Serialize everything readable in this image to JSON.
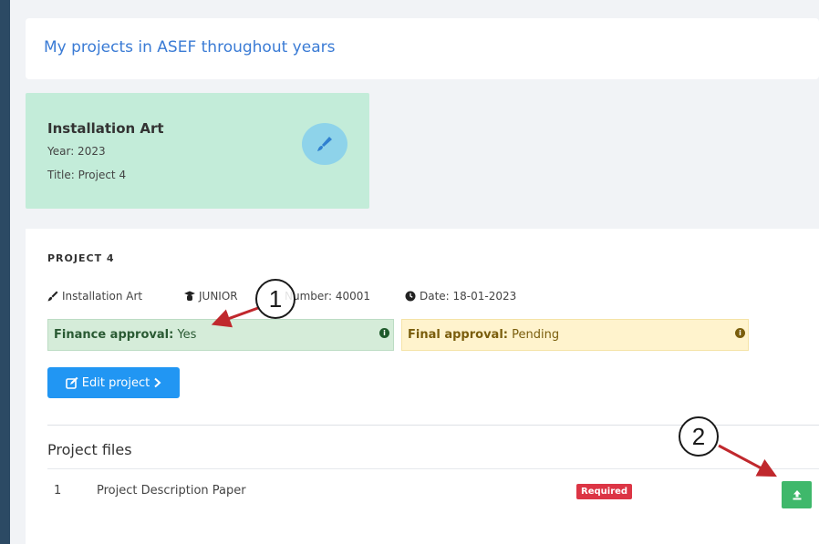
{
  "page_title": "My projects in ASEF throughout years",
  "project_tile": {
    "category": "Installation Art",
    "year_line": "Year: 2023",
    "title_line": "Title: Project 4",
    "icon": "paintbrush-icon"
  },
  "project": {
    "heading": "PROJECT 4",
    "meta": {
      "category": "Installation Art",
      "level": "JUNIOR",
      "number": "Number: 40001",
      "date": "Date: 18-01-2023"
    },
    "finance_approval": {
      "label": "Finance approval:",
      "value": "Yes"
    },
    "final_approval": {
      "label": "Final approval:",
      "value": "Pending"
    },
    "edit_button": "Edit project"
  },
  "files": {
    "heading": "Project files",
    "rows": [
      {
        "num": "1",
        "name": "Project Description Paper",
        "badge": "Required"
      }
    ]
  },
  "callouts": {
    "one": "1",
    "two": "2"
  },
  "colors": {
    "accent": "#3a7bd5",
    "tile_bg": "#c3ecd9",
    "finance_bg": "#d5ecd9",
    "final_bg": "#fff3cd",
    "edit_button": "#2196f3",
    "badge_required": "#dc3545",
    "upload_button": "#3fb86b",
    "annotation_arrow": "#c0282d"
  }
}
